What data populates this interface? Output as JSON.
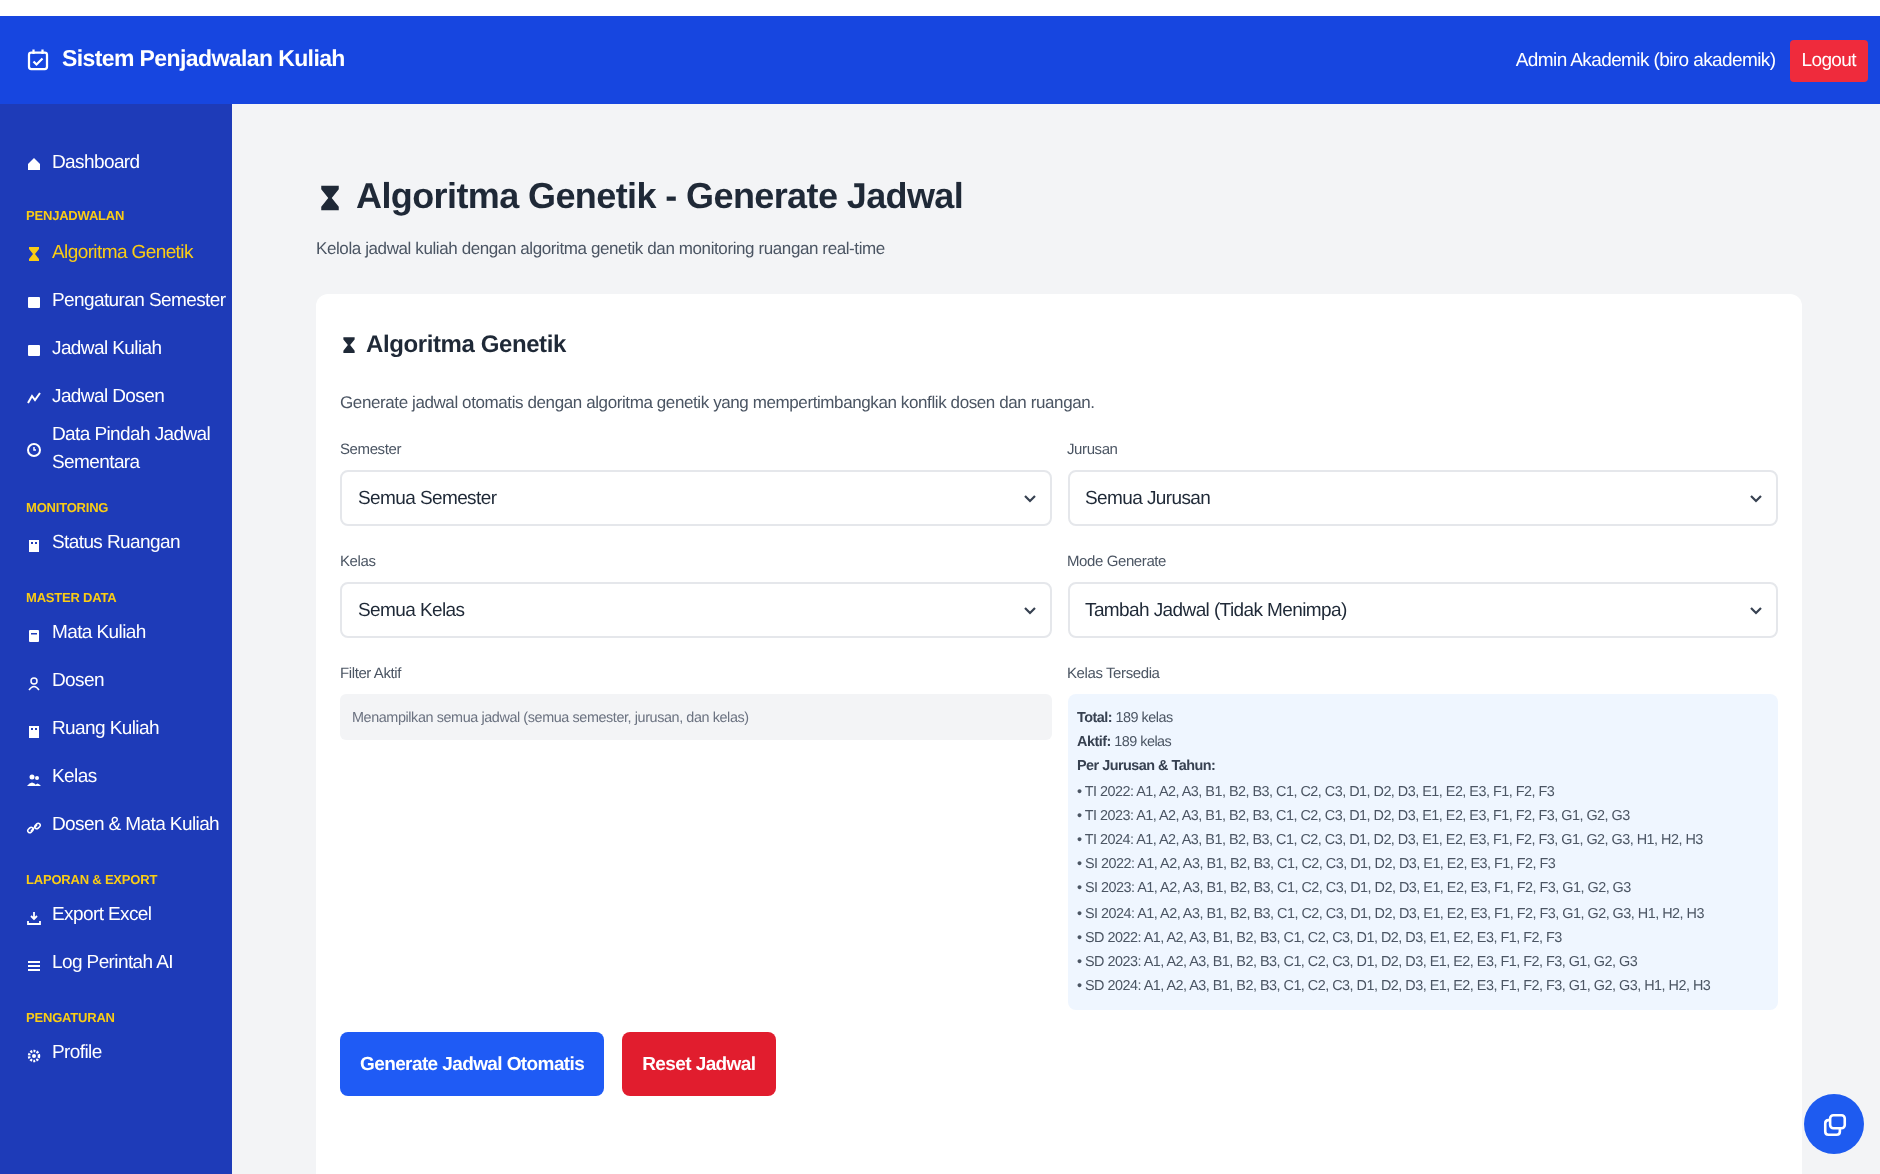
{
  "header": {
    "title": "Sistem Penjadwalan Kuliah",
    "user": "Admin Akademik (biro akademik)",
    "logout": "Logout"
  },
  "sidebar": {
    "sections": [
      {
        "items": [
          {
            "label": "Dashboard",
            "selected": false
          }
        ]
      },
      {
        "heading": "PENJADWALAN",
        "items": [
          {
            "label": "Algoritma Genetik",
            "selected": true
          },
          {
            "label": "Pengaturan Semester",
            "selected": false
          },
          {
            "label": "Jadwal Kuliah",
            "selected": false
          },
          {
            "label": "Jadwal Dosen",
            "selected": false
          },
          {
            "label": "Data Pindah Jadwal Sementara",
            "selected": false
          }
        ]
      },
      {
        "heading": "MONITORING",
        "items": [
          {
            "label": "Status Ruangan",
            "selected": false
          }
        ]
      },
      {
        "heading": "MASTER DATA",
        "items": [
          {
            "label": "Mata Kuliah",
            "selected": false
          },
          {
            "label": "Dosen",
            "selected": false
          },
          {
            "label": "Ruang Kuliah",
            "selected": false
          },
          {
            "label": "Kelas",
            "selected": false
          },
          {
            "label": "Dosen & Mata Kuliah",
            "selected": false
          }
        ]
      },
      {
        "heading": "LAPORAN & EXPORT",
        "items": [
          {
            "label": "Export Excel",
            "selected": false
          },
          {
            "label": "Log Perintah AI",
            "selected": false
          }
        ]
      },
      {
        "heading": "PENGATURAN",
        "items": [
          {
            "label": "Profile",
            "selected": false
          }
        ]
      }
    ]
  },
  "page": {
    "title": "Algoritma Genetik - Generate Jadwal",
    "subtitle": "Kelola jadwal kuliah dengan algoritma genetik dan monitoring ruangan real-time"
  },
  "card": {
    "title": "Algoritma Genetik",
    "description": "Generate jadwal otomatis dengan algoritma genetik yang mempertimbangkan konflik dosen dan ruangan.",
    "fields": [
      {
        "label": "Semester",
        "value": "Semua Semester"
      },
      {
        "label": "Jurusan",
        "value": "Semua Jurusan"
      },
      {
        "label": "Kelas",
        "value": "Semua Kelas"
      },
      {
        "label": "Mode Generate",
        "value": "Tambah Jadwal (Tidak Menimpa)"
      }
    ],
    "filter": {
      "label": "Filter Aktif",
      "text": "Menampilkan semua jadwal (semua semester, jurusan, dan kelas)"
    },
    "available": {
      "label": "Kelas Tersedia",
      "summary": [
        "**Total:** 189 kelas",
        "**Aktif:** 189 kelas"
      ],
      "heading": "Per Jurusan & Tahun:",
      "lines": [
        "• TI 2022: A1, A2, A3, B1, B2, B3, C1, C2, C3, D1, D2, D3, E1, E2, E3, F1, F2, F3",
        "• TI 2023: A1, A2, A3, B1, B2, B3, C1, C2, C3, D1, D2, D3, E1, E2, E3, F1, F2, F3, G1, G2, G3",
        "• TI 2024: A1, A2, A3, B1, B2, B3, C1, C2, C3, D1, D2, D3, E1, E2, E3, F1, F2, F3, G1, G2, G3, H1, H2, H3",
        "• SI 2022: A1, A2, A3, B1, B2, B3, C1, C2, C3, D1, D2, D3, E1, E2, E3, F1, F2, F3",
        "• SI 2023: A1, A2, A3, B1, B2, B3, C1, C2, C3, D1, D2, D3, E1, E2, E3, F1, F2, F3, G1, G2, G3",
        "• SI 2024: A1, A2, A3, B1, B2, B3, C1, C2, C3, D1, D2, D3, E1, E2, E3, F1, F2, F3, G1, G2, G3, H1, H2, H3",
        "• SD 2022: A1, A2, A3, B1, B2, B3, C1, C2, C3, D1, D2, D3, E1, E2, E3, F1, F2, F3",
        "• SD 2023: A1, A2, A3, B1, B2, B3, C1, C2, C3, D1, D2, D3, E1, E2, E3, F1, F2, F3, G1, G2, G3",
        "• SD 2024: A1, A2, A3, B1, B2, B3, C1, C2, C3, D1, D2, D3, E1, E2, E3, F1, F2, F3, G1, G2, G3, H1, H2, H3"
      ]
    },
    "buttons": [
      {
        "label": "Generate Jadwal Otomatis",
        "kind": "primary"
      },
      {
        "label": "Reset Jadwal",
        "kind": "danger"
      }
    ]
  }
}
